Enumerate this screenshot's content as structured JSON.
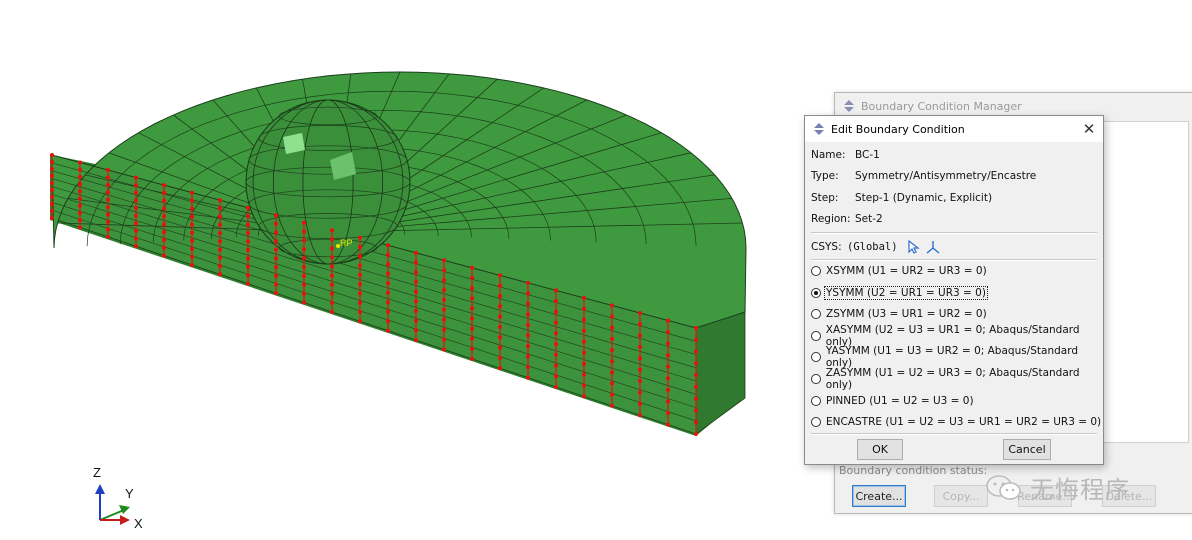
{
  "viewport": {
    "rp_label": "RP",
    "triad": {
      "x": "X",
      "y": "Y",
      "z": "Z"
    },
    "colors": {
      "mesh_green": "#3f9a3f",
      "node_red": "#e8120c",
      "rp_yellow": "#e6e600"
    }
  },
  "manager": {
    "title": "Boundary Condition Manager",
    "status_label": "Boundary condition status:",
    "buttons": [
      "Create...",
      "Copy...",
      "Rename...",
      "Delete..."
    ]
  },
  "dialog": {
    "title": "Edit Boundary Condition",
    "fields": [
      {
        "label": "Name:",
        "value": "BC-1"
      },
      {
        "label": "Type:",
        "value": "Symmetry/Antisymmetry/Encastre"
      },
      {
        "label": "Step:",
        "value": "Step-1 (Dynamic, Explicit)"
      },
      {
        "label": "Region:",
        "value": "Set-2"
      }
    ],
    "csys": {
      "label": "CSYS:",
      "value": "(Global)"
    },
    "options": [
      {
        "label": "XSYMM (U1 = UR2 = UR3 = 0)",
        "selected": false
      },
      {
        "label": "YSYMM (U2 = UR1 = UR3 = 0)",
        "selected": true
      },
      {
        "label": "ZSYMM (U3 = UR1 = UR2 = 0)",
        "selected": false
      },
      {
        "label": "XASYMM (U2 = U3 = UR1 = 0; Abaqus/Standard only)",
        "selected": false
      },
      {
        "label": "YASYMM (U1 = U3 = UR2 = 0; Abaqus/Standard only)",
        "selected": false
      },
      {
        "label": "ZASYMM (U1 = U2 = UR3 = 0; Abaqus/Standard only)",
        "selected": false
      },
      {
        "label": "PINNED (U1 = U2 = U3 = 0)",
        "selected": false
      },
      {
        "label": "ENCASTRE (U1 = U2 = U3 = UR1 = UR2 = UR3 = 0)",
        "selected": false
      }
    ],
    "ok_label": "OK",
    "cancel_label": "Cancel"
  },
  "watermark": {
    "text": "无悔程序",
    "icon": "wechat-icon"
  }
}
